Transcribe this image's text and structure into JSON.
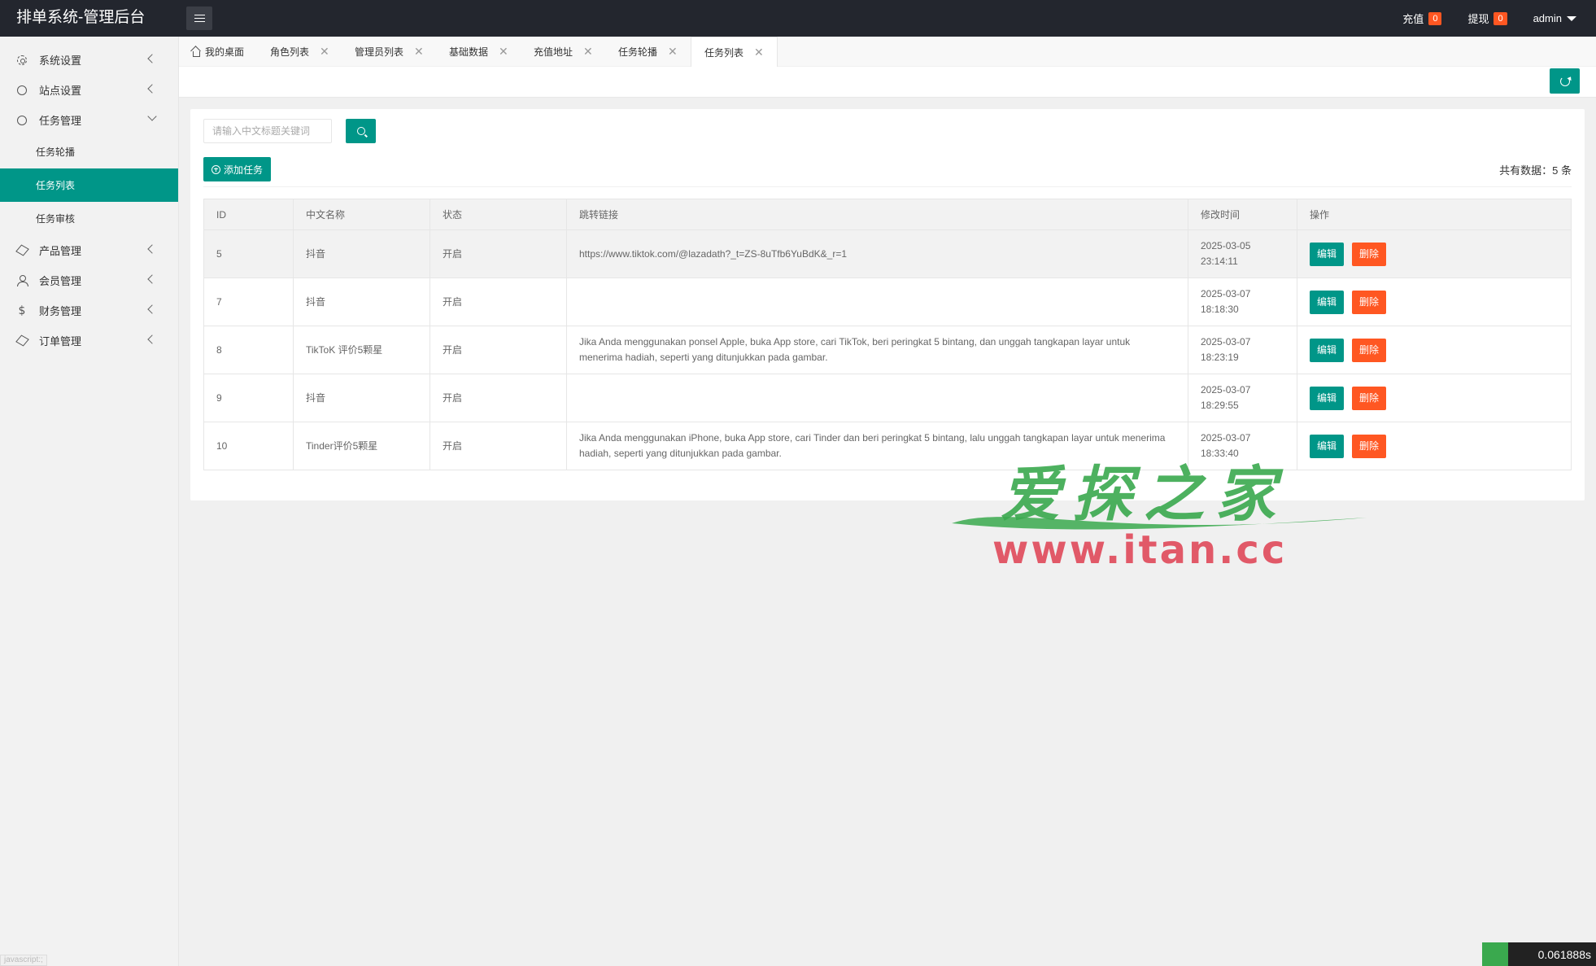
{
  "header": {
    "title": "排单系统-管理后台",
    "recharge_label": "充值",
    "recharge_count": "0",
    "withdraw_label": "提现",
    "withdraw_count": "0",
    "user": "admin"
  },
  "sidebar": {
    "items": [
      {
        "label": "系统设置",
        "icon": "gear-icon"
      },
      {
        "label": "站点设置",
        "icon": "ring-icon"
      },
      {
        "label": "任务管理",
        "icon": "ring-icon"
      },
      {
        "label": "产品管理",
        "icon": "cube-icon"
      },
      {
        "label": "会员管理",
        "icon": "user-icon"
      },
      {
        "label": "财务管理",
        "icon": "dollar-icon"
      },
      {
        "label": "订单管理",
        "icon": "cube-icon"
      }
    ],
    "sub_items": [
      "任务轮播",
      "任务列表",
      "任务审核"
    ]
  },
  "tabs": [
    "我的桌面",
    "角色列表",
    "管理员列表",
    "基础数据",
    "充值地址",
    "任务轮播",
    "任务列表"
  ],
  "toolbar": {
    "search_placeholder": "请输入中文标题关键词",
    "add_label": "添加任务",
    "total": "共有数据：5 条"
  },
  "table": {
    "headers": [
      "ID",
      "中文名称",
      "状态",
      "跳转链接",
      "修改时间",
      "操作"
    ],
    "rows": [
      {
        "id": "5",
        "name": "抖音",
        "status": "开启",
        "link": "https://www.tiktok.com/@lazadath?_t=ZS-8uTfb6YuBdK&_r=1",
        "time": "2025-03-05 23:14:11"
      },
      {
        "id": "7",
        "name": "抖音",
        "status": "开启",
        "link": "",
        "time": "2025-03-07 18:18:30"
      },
      {
        "id": "8",
        "name": "TikToK 评价5颗星",
        "status": "开启",
        "link": "Jika Anda menggunakan ponsel Apple, buka App store, cari TikTok, beri peringkat 5 bintang, dan unggah tangkapan layar untuk menerima hadiah, seperti yang ditunjukkan pada gambar.",
        "time": "2025-03-07 18:23:19"
      },
      {
        "id": "9",
        "name": "抖音",
        "status": "开启",
        "link": "",
        "time": "2025-03-07 18:29:55"
      },
      {
        "id": "10",
        "name": "Tinder评价5颗星",
        "status": "开启",
        "link": "Jika Anda menggunakan iPhone, buka App store, cari Tinder dan beri peringkat 5 bintang, lalu unggah tangkapan layar untuk menerima hadiah, seperti yang ditunjukkan pada gambar.",
        "time": "2025-03-07 18:33:40"
      }
    ],
    "edit_label": "编辑",
    "delete_label": "删除"
  },
  "watermark": {
    "title": "爱探之家",
    "url": "www.itan.cc"
  },
  "timer": "0.061888s",
  "status_text": "javascript:;",
  "colors": {
    "primary": "#009688",
    "danger": "#ff5722",
    "header": "#23262e"
  }
}
